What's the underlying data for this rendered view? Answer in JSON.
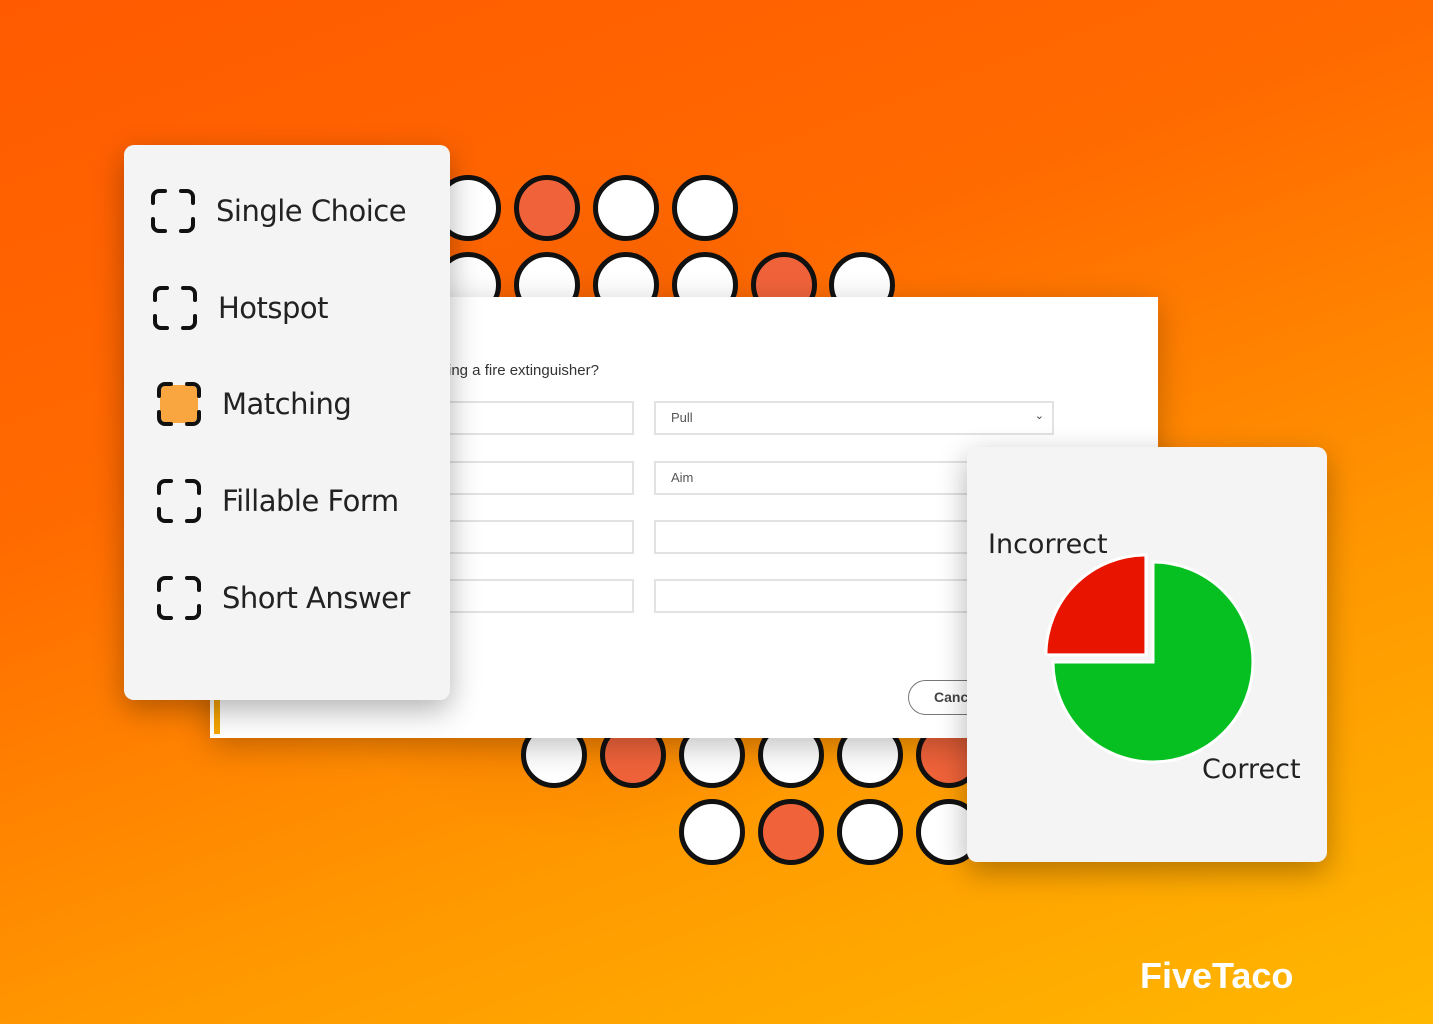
{
  "question_types": [
    {
      "label": "Single Choice",
      "selected": false
    },
    {
      "label": "Hotspot",
      "selected": false
    },
    {
      "label": "Matching",
      "selected": true
    },
    {
      "label": "Fillable Form",
      "selected": false
    },
    {
      "label": "Short Answer",
      "selected": false
    }
  ],
  "dialog": {
    "question": "ing a fire extinguisher?",
    "answers": [
      "Pull",
      "Aim",
      "",
      ""
    ],
    "cancel_label": "Canc"
  },
  "results_chart": {
    "type": "pie",
    "slices": [
      {
        "label": "Incorrect",
        "value": 25,
        "color": "#e81400"
      },
      {
        "label": "Correct",
        "value": 75,
        "color": "#05c020"
      }
    ]
  },
  "colors": {
    "accent": "#f9a540",
    "dot_orange": "#f0633a"
  },
  "brand": "FiveTaco"
}
